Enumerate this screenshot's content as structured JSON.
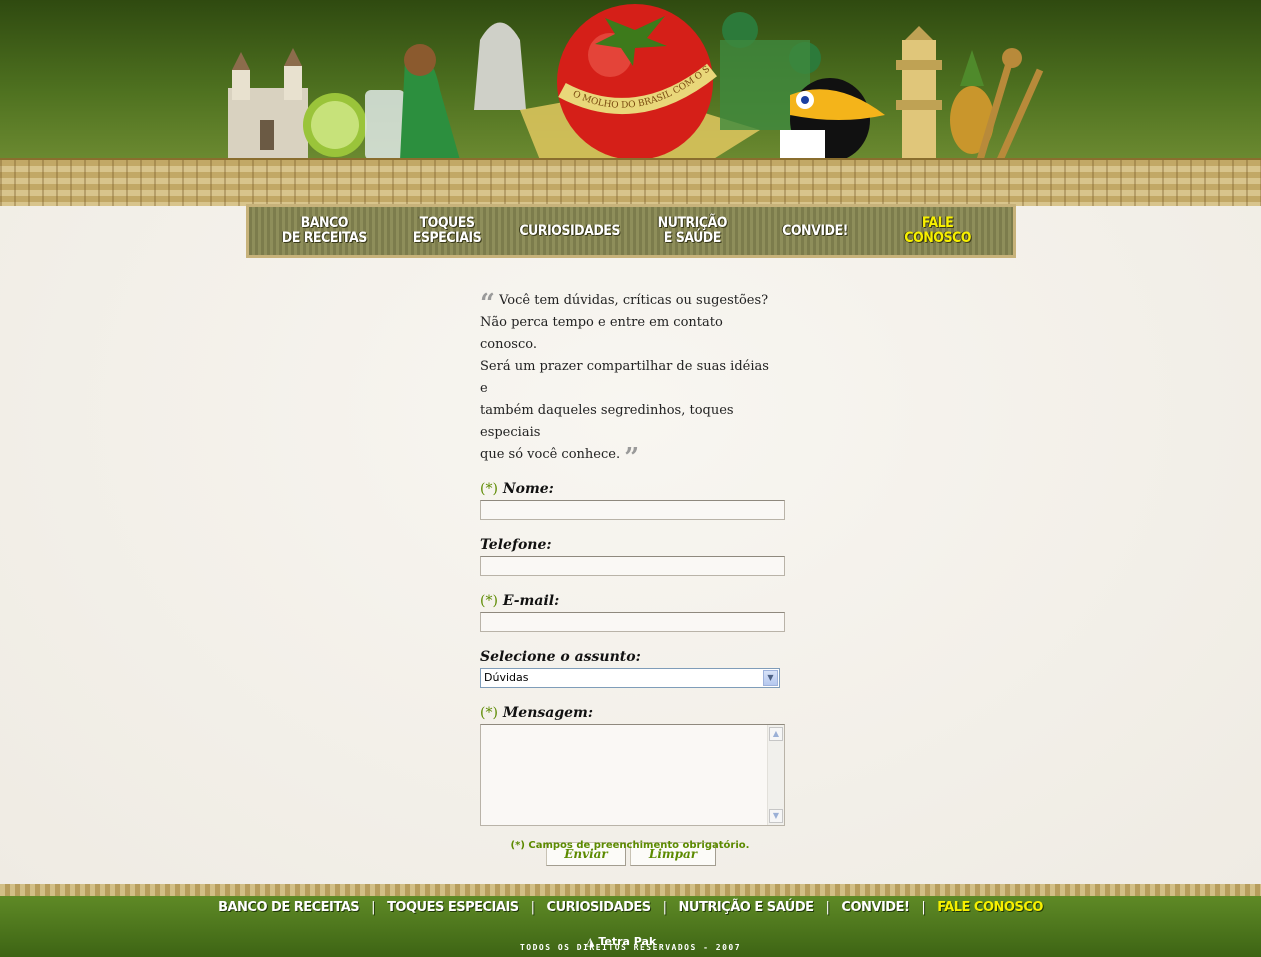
{
  "header": {
    "badge_text": "O MOLHO DO BRASIL COM O SEU TOQUE"
  },
  "nav": {
    "items": [
      {
        "label": "BANCO\nDE RECEITAS"
      },
      {
        "label": "TOQUES\nESPECIAIS"
      },
      {
        "label": "CURIOSIDADES"
      },
      {
        "label": "NUTRIÇÃO\nE SAÚDE"
      },
      {
        "label": "CONVIDE!"
      },
      {
        "label": "FALE\nCONOSCO"
      }
    ]
  },
  "intro": {
    "line1": "Você tem dúvidas, críticas ou sugestões?",
    "line2": "Não perca tempo e entre em contato conosco.",
    "line3": "Será um prazer compartilhar de suas idéias e",
    "line4": "também daqueles segredinhos, toques especiais",
    "line5": "que só você conhece."
  },
  "form": {
    "required_marker": "(*)",
    "nome_label": "Nome:",
    "nome_value": "",
    "telefone_label": "Telefone:",
    "telefone_value": "",
    "email_label": "E-mail:",
    "email_value": "",
    "assunto_label": "Selecione o assunto:",
    "assunto_value": "Dúvidas",
    "mensagem_label": "Mensagem:",
    "mensagem_value": "",
    "send_label": "Enviar",
    "clear_label": "Limpar",
    "note": "(*) Campos de preenchimento obrigatório."
  },
  "footer": {
    "links": [
      "BANCO DE RECEITAS",
      "TOQUES ESPECIAIS",
      "CURIOSIDADES",
      "NUTRIÇÃO E SAÚDE",
      "CONVIDE!",
      "FALE CONOSCO"
    ],
    "separator": "|",
    "brand": "Tetra Pak",
    "copyright": "TODOS OS DIREITOS RESERVADOS  - 2007"
  },
  "colors": {
    "accent_green": "#5c8a00",
    "active_nav": "#f7f000"
  }
}
